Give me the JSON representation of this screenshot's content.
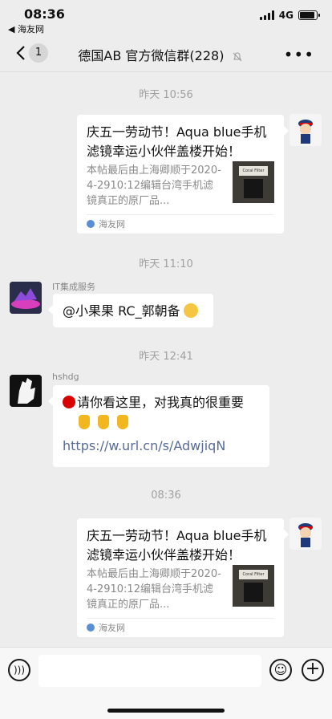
{
  "status_bar": {
    "time": "08:36",
    "back_app": "◀ 海友网",
    "network": "4G"
  },
  "nav": {
    "back_icon": "chevron-left-icon",
    "unread_count": "1",
    "title": "德国AB 官方微信群(228)",
    "mute_icon": "bell-off-icon",
    "more_icon": "more-icon"
  },
  "messages": {
    "ts1": "昨天 10:56",
    "card1": {
      "title": "庆五一劳动节！Aqua blue手机滤镜幸运小伙伴盖楼开始！",
      "desc": "本帖最后由上海卿顺于2020-4-2910:12编辑台湾手机滤镜真正的原厂品...",
      "thumb_label": "Coral Filter",
      "source": "海友网"
    },
    "ts2": "昨天 11:10",
    "it_service": {
      "name": "IT集成服务",
      "text": "@小果果 RC_郭朝备"
    },
    "ts3": "昨天 12:41",
    "hshdg": {
      "name": "hshdg",
      "text": "请你看这里，对我真的很重要",
      "link": "https://w.url.cn/s/AdwjiqN"
    },
    "ts4": "08:36",
    "card2": {
      "title": "庆五一劳动节！Aqua blue手机滤镜幸运小伙伴盖楼开始！",
      "desc": "本帖最后由上海卿顺于2020-4-2910:12编辑台湾手机滤镜真正的原厂品...",
      "thumb_label": "Coral Filter",
      "source": "海友网"
    }
  },
  "input": {
    "voice_icon": "voice-icon",
    "placeholder": "",
    "emoji_icon": "emoji-icon",
    "plus_icon": "plus-icon"
  },
  "colors": {
    "background": "#ededed",
    "bubble": "#ffffff",
    "link": "#576b95",
    "timestamp": "#a1a1a1"
  }
}
